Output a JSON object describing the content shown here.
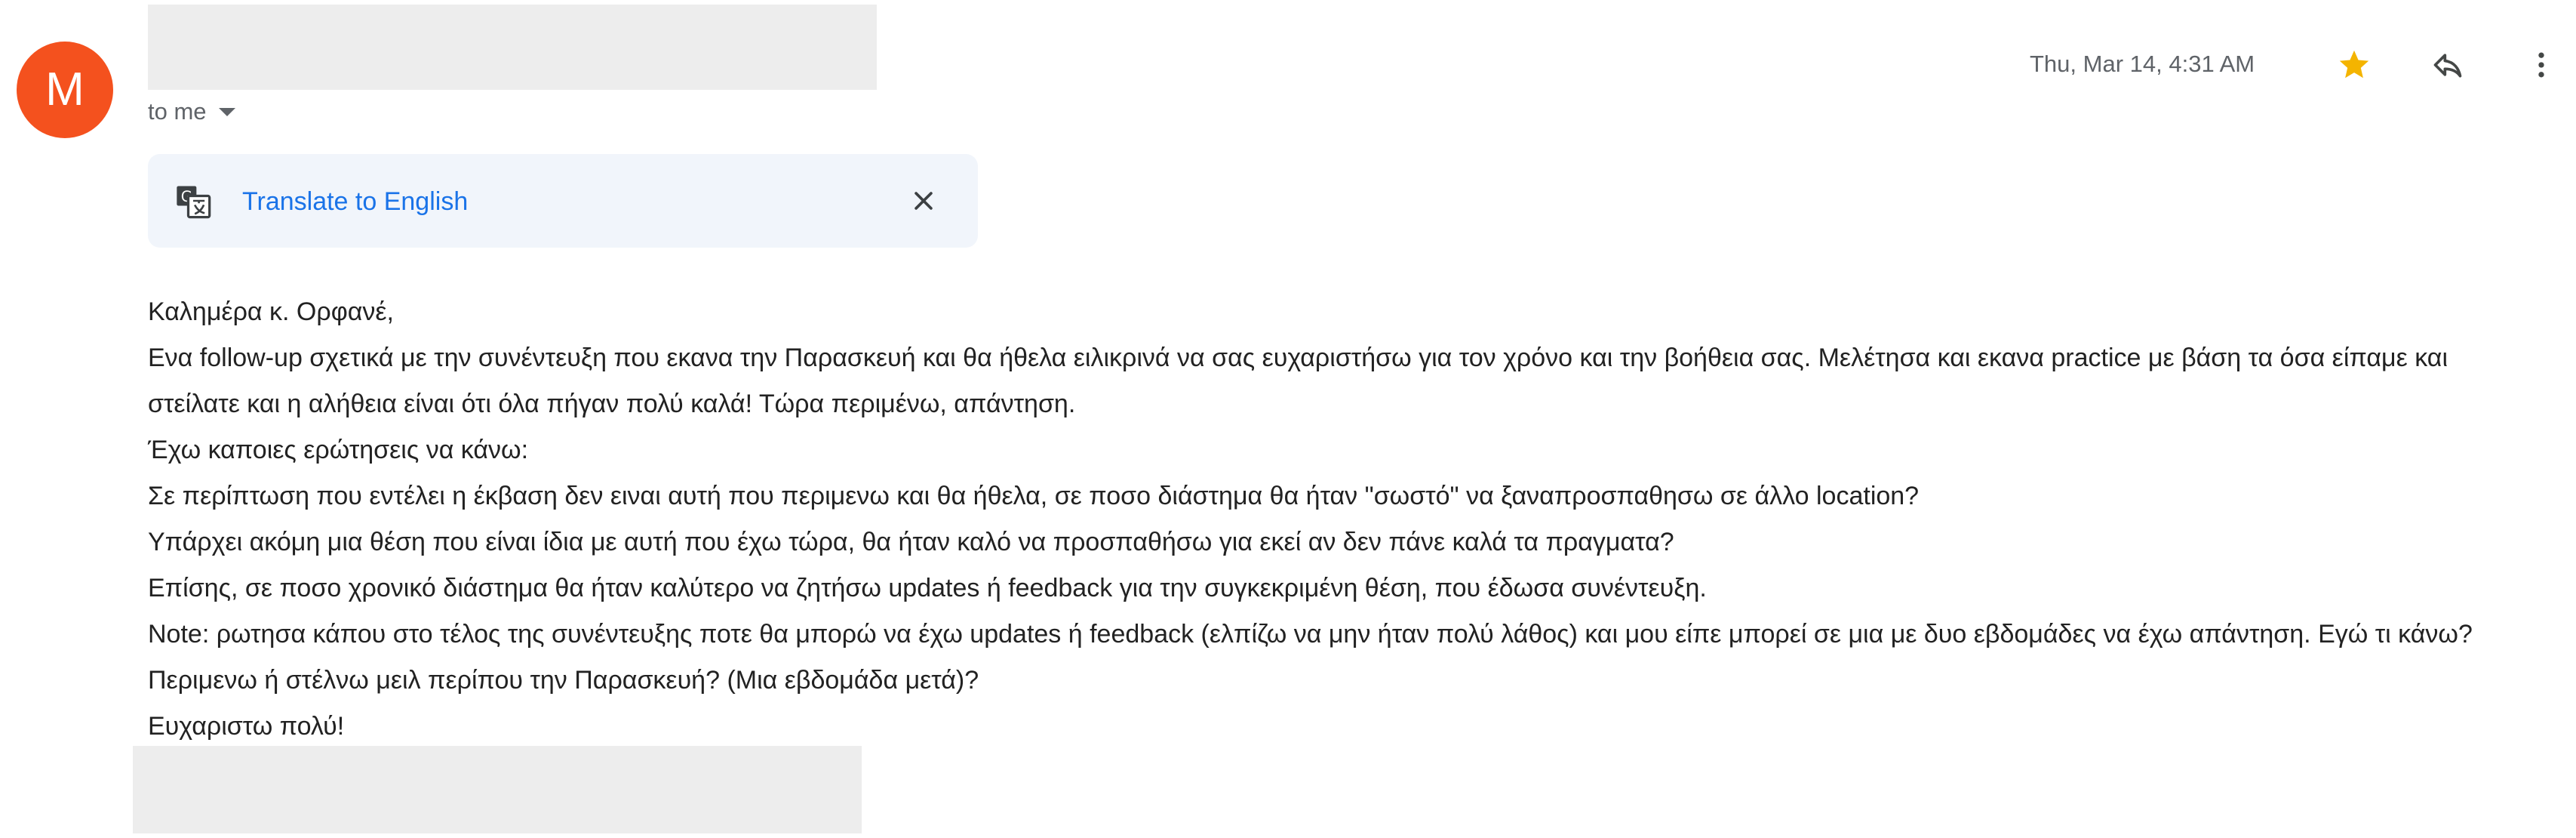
{
  "sender": {
    "avatar_letter": "M",
    "avatar_color": "#f4511e"
  },
  "recipient": {
    "to_label": "to me"
  },
  "header": {
    "timestamp": "Thu, Mar 14, 4:31 AM",
    "star_color": "#f4b400",
    "icons": [
      "star-icon",
      "reply-icon",
      "more-vert-icon"
    ]
  },
  "translate": {
    "link_text": "Translate to English",
    "icon": "translate-icon",
    "close_icon": "close-icon",
    "link_color": "#1a73e8"
  },
  "message": {
    "greeting": "Καλημέρα κ. Ορφανέ,",
    "paragraph_1": "Ενα follow-up σχετικά με την συνέντευξη που εκανα   την Παρασκευή και θα ήθελα ειλικρινά να σας ευχαριστήσω για τον χρόνο και την βοήθεια σας. Μελέτησα και εκανα practice με βάση τα όσα είπαμε και στείλατε και η αλήθεια είναι ότι όλα πήγαν πολύ καλά! Τώρα περιμένω, απάντηση.",
    "questions_intro": "Έχω καποιες ερώτησεις να κάνω:",
    "question_1": "Σε περίπτωση που εντέλει η έκβαση δεν ειναι αυτή που περιμενω και θα ήθελα, σε ποσο διάστημα θα ήταν \"σωστό\" να ξαναπροσπαθησω σε άλλο location?",
    "question_2": "Υπάρχει ακόμη μια θέση που είναι ίδια με αυτή που έχω τώρα, θα ήταν καλό να προσπαθήσω για εκεί αν δεν πάνε καλά τα πραγματα?",
    "question_3": "Επίσης, σε ποσο χρονικό διάστημα θα ήταν καλύτερο να ζητήσω updates ή feedback για την συγκεκριμένη θέση, που έδωσα συνέντευξη.",
    "note": "Note: ρωτησα κάπου στο τέλος της συνέντευξης ποτε θα μπορώ να έχω updates ή feedback (ελπίζω να μην ήταν πολύ λάθος) και μου είπε μπορεί σε μια με δυο εβδομάδες να έχω απάντηση. Εγώ τι κάνω? Περιμενω ή στέλνω μειλ περίπου την Παρασκευή? (Μια εβδομάδα μετά)?",
    "closing": "Ευχαριστω πολύ!"
  }
}
